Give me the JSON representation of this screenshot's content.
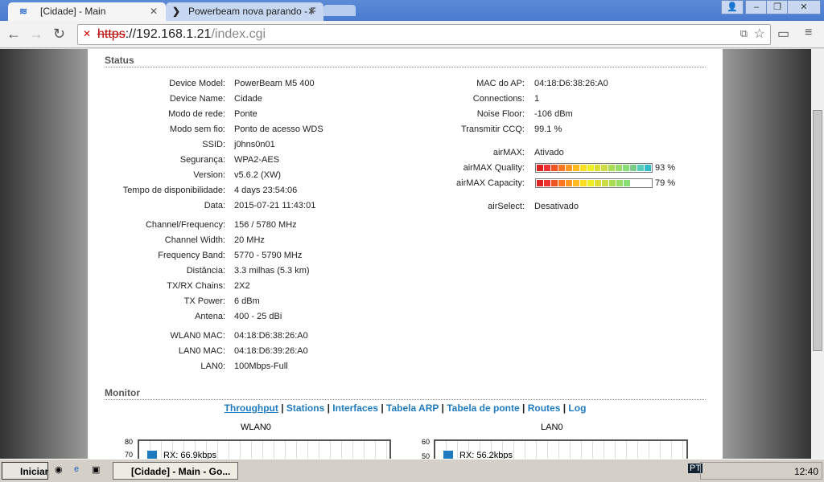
{
  "browser": {
    "tabs": [
      {
        "title": "[Cidade] - Main"
      },
      {
        "title": "Powerbeam nova parando - F"
      }
    ],
    "url_scheme": "https",
    "url_host": "://192.168.1.21",
    "url_path": "/index.cgi"
  },
  "status": {
    "title": "Status",
    "left": [
      {
        "label": "Device Model:",
        "value": "PowerBeam M5 400"
      },
      {
        "label": "Device Name:",
        "value": "Cidade"
      },
      {
        "label": "Modo de rede:",
        "value": "Ponte"
      },
      {
        "label": "Modo sem fio:",
        "value": "Ponto de acesso WDS"
      },
      {
        "label": "SSID:",
        "value": "j0hns0n01"
      },
      {
        "label": "Segurança:",
        "value": "WPA2-AES"
      },
      {
        "label": "Version:",
        "value": "v5.6.2 (XW)"
      },
      {
        "label": "Tempo de disponibilidade:",
        "value": "4 days 23:54:06"
      },
      {
        "label": "Data:",
        "value": "2015-07-21 11:43:01"
      },
      {
        "label": "Channel/Frequency:",
        "value": "156 / 5780 MHz"
      },
      {
        "label": "Channel Width:",
        "value": "20 MHz"
      },
      {
        "label": "Frequency Band:",
        "value": "5770 - 5790 MHz"
      },
      {
        "label": "Distância:",
        "value": "3.3 milhas (5.3 km)"
      },
      {
        "label": "TX/RX Chains:",
        "value": "2X2"
      },
      {
        "label": "TX Power:",
        "value": "6 dBm"
      },
      {
        "label": "Antena:",
        "value": "400 - 25 dBi"
      },
      {
        "label": "WLAN0 MAC:",
        "value": "04:18:D6:38:26:A0"
      },
      {
        "label": "LAN0 MAC:",
        "value": "04:18:D6:39:26:A0"
      },
      {
        "label": "LAN0:",
        "value": "100Mbps-Full"
      }
    ],
    "right": [
      {
        "label": "MAC do AP:",
        "value": "04:18:D6:38:26:A0"
      },
      {
        "label": "Connections:",
        "value": "1"
      },
      {
        "label": "Noise Floor:",
        "value": "-106 dBm"
      },
      {
        "label": "Transmitir CCQ:",
        "value": "99.1 %"
      },
      {
        "label": "airMAX:",
        "value": "Ativado"
      },
      {
        "label": "airMAX Quality:",
        "value": "93 %",
        "percent": 93
      },
      {
        "label": "airMAX Capacity:",
        "value": "79 %",
        "percent": 79
      },
      {
        "label": "airSelect:",
        "value": "Desativado"
      }
    ]
  },
  "monitor": {
    "title": "Monitor",
    "links": [
      "Throughput",
      "Stations",
      "Interfaces",
      "Tabela ARP",
      "Tabela de ponte",
      "Routes",
      "Log"
    ],
    "charts": [
      {
        "title": "WLAN0",
        "ticks": [
          "80",
          "70"
        ],
        "legend": "RX: 66.9kbps"
      },
      {
        "title": "LAN0",
        "ticks": [
          "60",
          "50"
        ],
        "legend": "RX: 56.2kbps"
      }
    ]
  },
  "taskbar": {
    "start": "Iniciar",
    "task": "[Cidade] - Main - Go...",
    "clock": "12:40"
  }
}
